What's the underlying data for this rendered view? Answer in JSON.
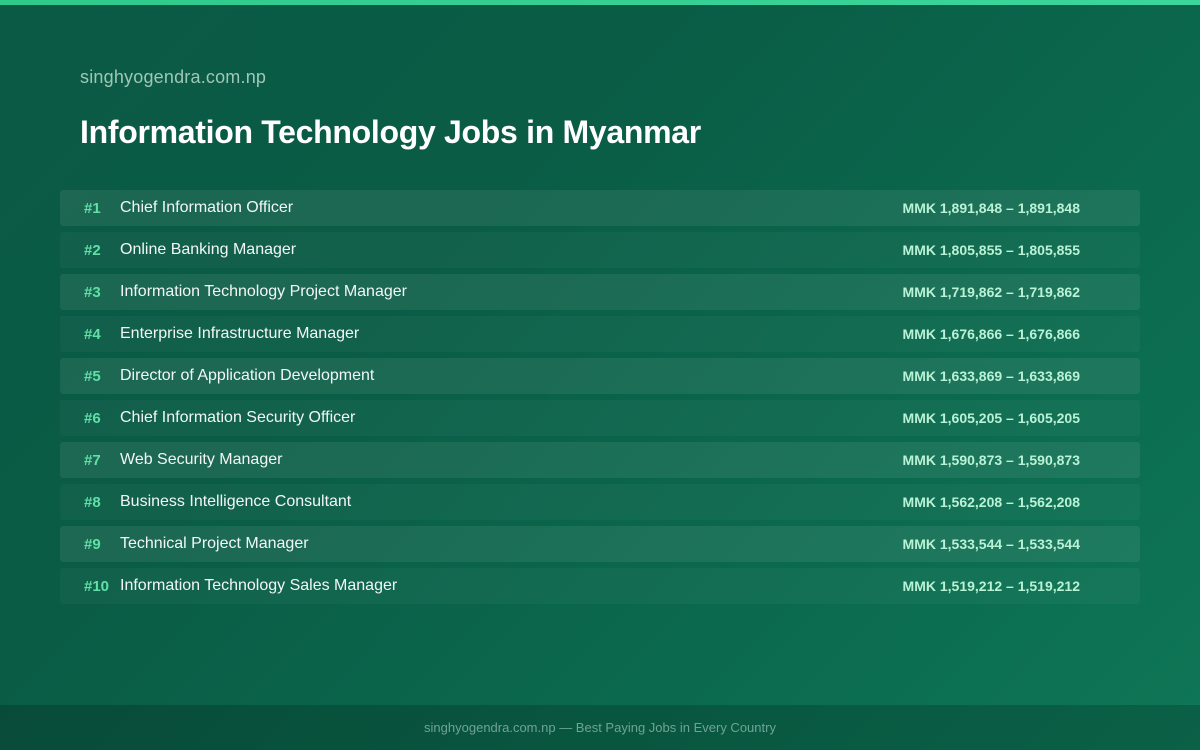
{
  "header": {
    "site": "singhyogendra.com.np",
    "title": "Information Technology Jobs in Myanmar"
  },
  "jobs": [
    {
      "rank": "#1",
      "title": "Chief Information Officer",
      "salary": "MMK 1,891,848 – 1,891,848"
    },
    {
      "rank": "#2",
      "title": "Online Banking Manager",
      "salary": "MMK 1,805,855 – 1,805,855"
    },
    {
      "rank": "#3",
      "title": "Information Technology Project Manager",
      "salary": "MMK 1,719,862 – 1,719,862"
    },
    {
      "rank": "#4",
      "title": "Enterprise Infrastructure Manager",
      "salary": "MMK 1,676,866 – 1,676,866"
    },
    {
      "rank": "#5",
      "title": "Director of Application Development",
      "salary": "MMK 1,633,869 – 1,633,869"
    },
    {
      "rank": "#6",
      "title": "Chief Information Security Officer",
      "salary": "MMK 1,605,205 – 1,605,205"
    },
    {
      "rank": "#7",
      "title": "Web Security Manager",
      "salary": "MMK 1,590,873 – 1,590,873"
    },
    {
      "rank": "#8",
      "title": "Business Intelligence Consultant",
      "salary": "MMK 1,562,208 – 1,562,208"
    },
    {
      "rank": "#9",
      "title": "Technical Project Manager",
      "salary": "MMK 1,533,544 – 1,533,544"
    },
    {
      "rank": "#10",
      "title": "Information Technology Sales Manager",
      "salary": "MMK 1,519,212 – 1,519,212"
    }
  ],
  "footer": {
    "text": "singhyogendra.com.np — Best Paying Jobs in Every Country"
  },
  "colors": {
    "background": "#0b5e48",
    "accent": "#3bd69a",
    "rank": "#5ee0a6",
    "salary": "#b9f2d6"
  }
}
